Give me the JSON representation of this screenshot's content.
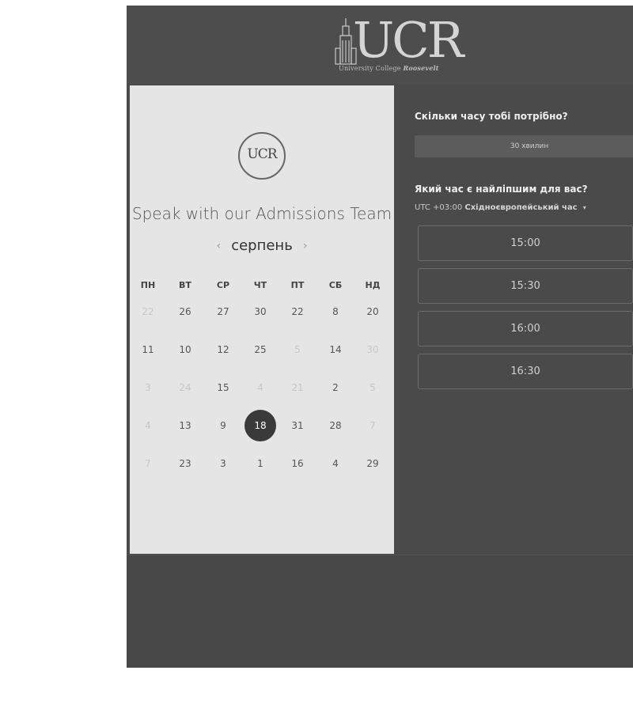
{
  "header": {
    "logo_letters": "UCR",
    "logo_subtitle_main": "University College",
    "logo_subtitle_accent": "Roosevelt"
  },
  "left_panel": {
    "emblem_text": "UCR",
    "headline": "Speak with our Admissions Team",
    "month": "серпень",
    "prev_arrow": "‹",
    "next_arrow": "›",
    "weekdays": [
      "ПН",
      "ВТ",
      "СР",
      "ЧТ",
      "ПТ",
      "СБ",
      "НД"
    ],
    "weeks": [
      [
        "22",
        "26",
        "27",
        "30",
        "22",
        "8",
        "20"
      ],
      [
        "11",
        "10",
        "12",
        "25",
        "5",
        "14",
        "30"
      ],
      [
        "3",
        "24",
        "15",
        "4",
        "21",
        "2",
        "5"
      ],
      [
        "4",
        "13",
        "9",
        "18",
        "31",
        "28",
        "7"
      ],
      [
        "7",
        "23",
        "3",
        "1",
        "16",
        "4",
        "29"
      ]
    ],
    "faint_cells": [
      "0-0",
      "1-4",
      "1-6",
      "2-0",
      "2-1",
      "2-3",
      "2-4",
      "2-6",
      "3-0",
      "3-6",
      "4-0"
    ],
    "selected_cell": "3-3"
  },
  "right_panel": {
    "duration_question": "Скільки часу тобі потрібно?",
    "duration_value": "30 хвилин",
    "time_question": "Який час є найліпшим для вас?",
    "timezone_offset": "UTC +03:00",
    "timezone_name": "Східноєвропейський час",
    "timezone_caret": "▾",
    "time_slots": [
      "15:00",
      "15:30",
      "16:00",
      "16:30"
    ]
  },
  "colors": {
    "page_bg": "#ffffff",
    "frame_bg": "#4a4a4a",
    "calendar_bg": "#e5e5e5",
    "selected_day": "#3a3a3a",
    "slot_border": "#6b6b6b"
  }
}
